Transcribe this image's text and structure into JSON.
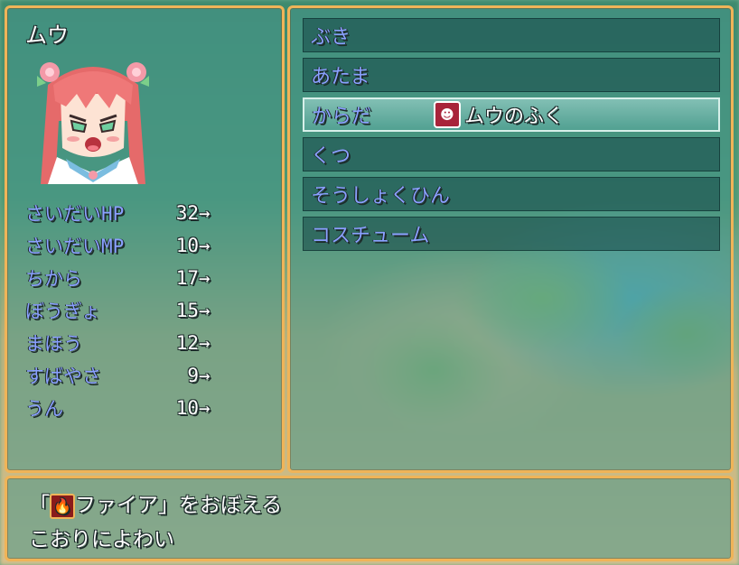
{
  "character": {
    "name": "ムウ"
  },
  "stats": [
    {
      "label": "さいだいHP",
      "value": "32",
      "arrow": "→"
    },
    {
      "label": "さいだいMP",
      "value": "10",
      "arrow": "→"
    },
    {
      "label": "ちから",
      "value": "17",
      "arrow": "→"
    },
    {
      "label": "ぼうぎょ",
      "value": "15",
      "arrow": "→"
    },
    {
      "label": "まほう",
      "value": "12",
      "arrow": "→"
    },
    {
      "label": "すばやさ",
      "value": "9",
      "arrow": "→"
    },
    {
      "label": "うん",
      "value": "10",
      "arrow": "→"
    }
  ],
  "equip_slots": [
    {
      "label": "ぶき",
      "item": ""
    },
    {
      "label": "あたま",
      "item": ""
    },
    {
      "label": "からだ",
      "item": "ムウのふく",
      "icon": "face-icon"
    },
    {
      "label": "くつ",
      "item": ""
    },
    {
      "label": "そうしょくひん",
      "item": ""
    },
    {
      "label": "コスチューム",
      "item": ""
    }
  ],
  "help": {
    "line1_open": "「",
    "line1_skill": "ファイア",
    "line1_close": "」をおぼえる",
    "line1_icon": "fire-icon",
    "line2": "こおりによわい"
  },
  "colors": {
    "frame": "#f0b458",
    "label_blue": "#8aa0ff",
    "selected_slot": "#9fd6d0"
  }
}
